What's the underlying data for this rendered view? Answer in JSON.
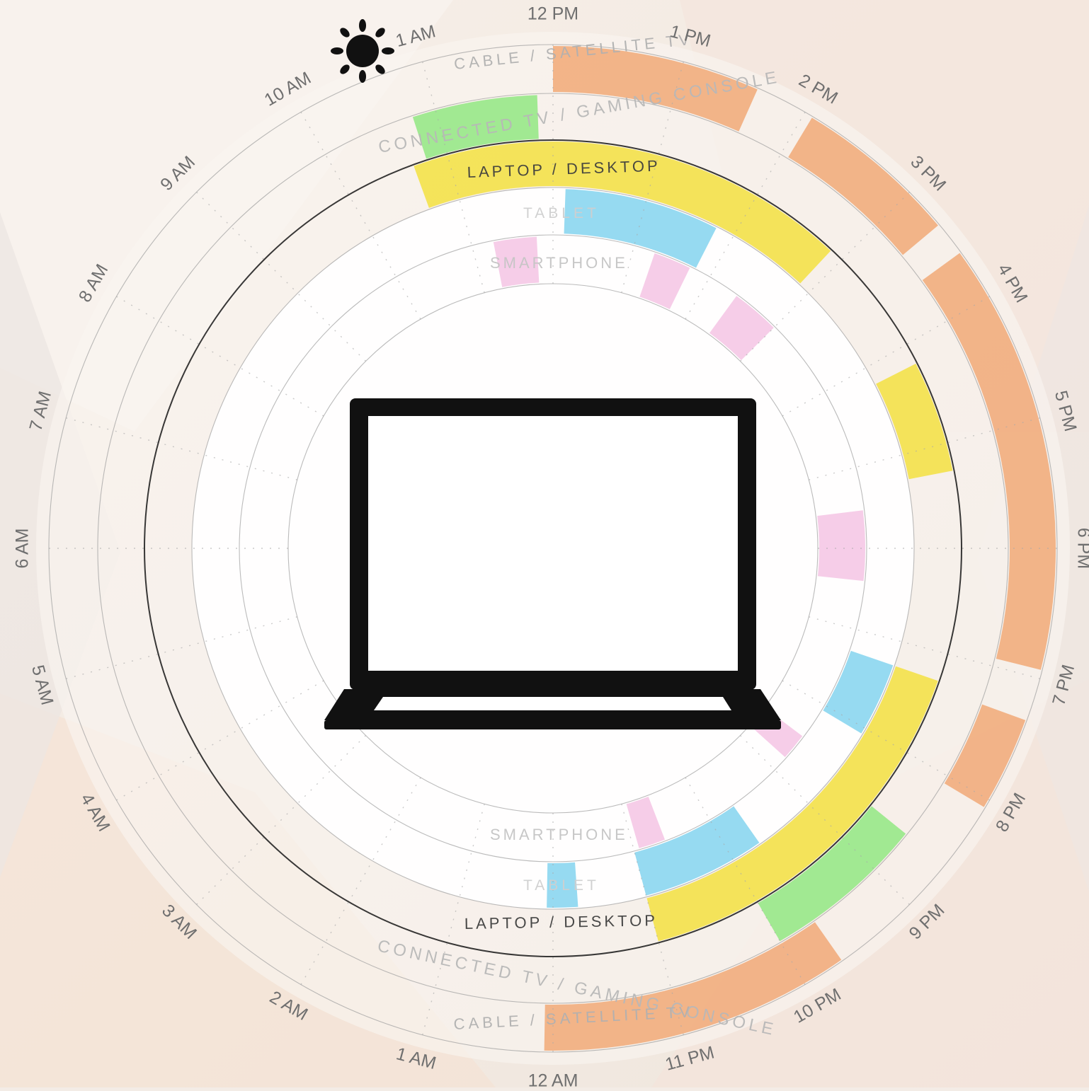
{
  "clock": {
    "top": [
      "12 PM",
      "1 PM",
      "2 PM",
      "3 PM",
      "4 PM",
      "5 PM",
      "6 PM",
      "7 PM",
      "8 PM",
      "9 PM",
      "10 PM",
      "11 PM",
      "12 AM",
      "1 AM",
      "2 AM",
      "3 AM",
      "4 AM",
      "5 AM",
      "6 AM",
      "7 AM",
      "8 AM",
      "9 AM",
      "10 AM",
      "1 AM"
    ]
  },
  "rings": {
    "cable": "CABLE / SATELLITE TV",
    "connected": "CONNECTED TV / GAMING CONSOLE",
    "laptop": "LAPTOP / DESKTOP",
    "tablet": "TABLET",
    "smartphone": "SMARTPHONE",
    "cable_bottom": "CABLE / SATELLITE TV",
    "connected_bottom": "CONNECTED TV / GAMING CONSOLE",
    "laptop_bottom": "LAPTOP / DESKTOP",
    "tablet_bottom": "TABLET",
    "smartphone_bottom": "SMARTPHONE"
  },
  "colors": {
    "cable": "#f2a773",
    "connected": "#8fe87f",
    "laptop": "#f4e13a",
    "tablet": "#7fd3ef",
    "smartphone": "#f3b7df",
    "ink": "#111111"
  },
  "icons": {
    "center": "laptop-icon",
    "marker": "sun-icon"
  }
}
